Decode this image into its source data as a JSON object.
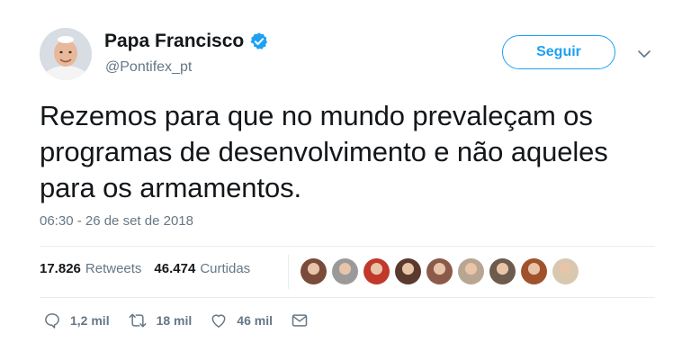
{
  "author": {
    "name": "Papa Francisco",
    "handle": "@Pontifex_pt",
    "verified": true,
    "verified_color": "#1da1f2"
  },
  "follow_button": {
    "label": "Seguir",
    "accent": "#1da1f2"
  },
  "menu_icon": "chevron-down-icon",
  "tweet": {
    "text": "Rezemos para que no mundo prevaleçam os programas de desenvolvimento e não aqueles para os armamentos.",
    "timestamp": "06:30 - 26 de set de 2018"
  },
  "stats": {
    "retweets_count": "17.826",
    "retweets_label": "Retweets",
    "likes_count": "46.474",
    "likes_label": "Curtidas"
  },
  "liker_avatars": [
    {
      "color": "#7a4b3a"
    },
    {
      "color": "#9a9a9a"
    },
    {
      "color": "#c0392b"
    },
    {
      "color": "#5a3a2e"
    },
    {
      "color": "#8b5a4a"
    },
    {
      "color": "#b8a692"
    },
    {
      "color": "#6d5b4d"
    },
    {
      "color": "#a0522d"
    },
    {
      "color": "#d8c8b0"
    }
  ],
  "actions": {
    "reply_count": "1,2 mil",
    "retweet_count": "18 mil",
    "like_count": "46 mil"
  }
}
